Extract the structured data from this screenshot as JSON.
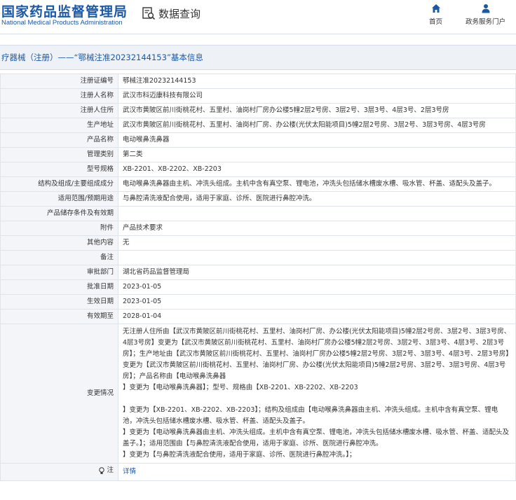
{
  "header": {
    "logo_cn": "国家药品监督管理局",
    "logo_en": "National Medical Products Administration",
    "query_label": "数据查询",
    "nav": [
      {
        "label": "首页",
        "icon": "home-icon"
      },
      {
        "label": "政务服务门户",
        "icon": "user-icon"
      }
    ]
  },
  "title_bar": {
    "text": "疗器械（注册）——“鄂械注准20232144153”基本信息"
  },
  "rows": [
    {
      "label": "注册证编号",
      "value": "鄂械注准20232144153"
    },
    {
      "label": "注册人名称",
      "value": "武汉市科迈康科技有限公司"
    },
    {
      "label": "注册人住所",
      "value": "武汉市黄陂区前川街桃花村、五里村、油岗村厂房办公楼5幢2层2号房、3层2号、3层3号、4层3号、2层3号房"
    },
    {
      "label": "生产地址",
      "value": "武汉市黄陂区前川街桃花村、五里村、油岗村厂房、办公楼(光伏太阳能项目)5幢2层2号房、3层2号、3层3号房、4层3号房"
    },
    {
      "label": "产品名称",
      "value": "电动喉鼻洗鼻器"
    },
    {
      "label": "管理类别",
      "value": "第二类"
    },
    {
      "label": "型号规格",
      "value": "XB-2201、XB-2202、XB-2203"
    },
    {
      "label": "结构及组成/主要组成成分",
      "value": "电动喉鼻洗鼻器由主机、冲洗头组成。主机中含有真空泵、锂电池，冲洗头包括储水槽废水槽、吸水管、杯盖、适配头及盖子。"
    },
    {
      "label": "适用范围/预期用途",
      "value": "与鼻腔清洗液配合使用，适用于家庭、诊所、医院进行鼻腔冲洗。"
    },
    {
      "label": "产品储存条件及有效期",
      "value": ""
    },
    {
      "label": "附件",
      "value": "产品技术要求"
    },
    {
      "label": "其他内容",
      "value": "无"
    },
    {
      "label": "备注",
      "value": ""
    },
    {
      "label": "审批部门",
      "value": "湖北省药品监督管理局"
    },
    {
      "label": "批准日期",
      "value": "2023-01-05"
    },
    {
      "label": "生效日期",
      "value": "2023-01-05"
    },
    {
      "label": "有效期至",
      "value": "2028-01-04"
    }
  ],
  "change": {
    "label": "变更情况",
    "value": "无注册人住所由【武汉市黄陂区前川街桃花村、五里村、油岗村厂房、办公楼(光伏太阳能项目)5幢2层2号房、3层2号、3层3号房、4层3号房】变更为【武汉市黄陂区前川街桃花村、五里村、油岗村厂房办公楼5幢2层2号房、3层2号、3层3号、4层3号、2层3号房】；生产地址由【武汉市黄陂区前川街桃花村、五里村、油岗村厂房办公楼5幢2层2号房、3层2号、3层3号、4层3号、2层3号房】变更为【武汉市黄陂区前川街桃花村、五里村、油岗村厂房、办公楼(光伏太阳能项目)5幢2层2号房、3层2号、3层3号房、4层3号房】；产品名称由【电动喉鼻洗鼻器\n】变更为【电动喉鼻洗鼻器】；型号、规格由【XB-2201、XB-2202、XB-2203\n\n】变更为【XB-2201、XB-2202、XB-2203】；结构及组成由【电动喉鼻洗鼻器由主机、冲洗头组成。主机中含有真空泵、锂电池，冲洗头包括储水槽废水槽、吸水管、杯盖、适配头及盖子。\n】变更为【电动喉鼻洗鼻器由主机、冲洗头组成。主机中含有真空泵、锂电池，冲洗头包括储水槽废水槽、吸水管、杯盖、适配头及盖子。】；适用范围由【与鼻腔清洗液配合使用，适用于家庭、诊所、医院进行鼻腔冲洗。\n】变更为【与鼻腔清洗液配合使用，适用于家庭、诊所、医院进行鼻腔冲洗。】；"
  },
  "note": {
    "label": "注",
    "icon": "lightbulb-icon",
    "link": "详情"
  }
}
